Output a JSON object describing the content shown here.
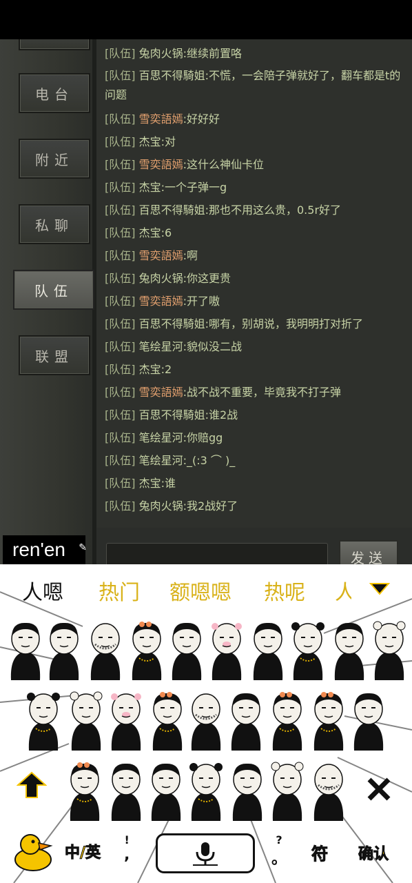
{
  "game": {
    "tabs": [
      {
        "label": "电台",
        "active": false
      },
      {
        "label": "附近",
        "active": false
      },
      {
        "label": "私聊",
        "active": false
      },
      {
        "label": "队伍",
        "active": true
      },
      {
        "label": "联盟",
        "active": false
      }
    ],
    "messages": [
      {
        "tag": "[队伍]",
        "name": "兔肉火锅",
        "text": ":继续前置咯",
        "orange": false
      },
      {
        "tag": "[队伍]",
        "name": "百思不得騎姐",
        "text": ":不慌，一会陪子弹就好了，翻车都是t的问题",
        "orange": false
      },
      {
        "tag": "[队伍]",
        "name": "雪奕語嫣",
        "text": ":好好好",
        "orange": true
      },
      {
        "tag": "[队伍]",
        "name": "杰宝",
        "text": ":对",
        "orange": false
      },
      {
        "tag": "[队伍]",
        "name": "雪奕語嫣",
        "text": ":这什么神仙卡位",
        "orange": true
      },
      {
        "tag": "[队伍]",
        "name": "杰宝",
        "text": ":一个子弹一g",
        "orange": false
      },
      {
        "tag": "[队伍]",
        "name": "百思不得騎姐",
        "text": ":那也不用这么贵，0.5r好了",
        "orange": false
      },
      {
        "tag": "[队伍]",
        "name": "杰宝",
        "text": ":6",
        "orange": false
      },
      {
        "tag": "[队伍]",
        "name": "雪奕語嫣",
        "text": ":啊",
        "orange": true
      },
      {
        "tag": "[队伍]",
        "name": "兔肉火锅",
        "text": ":你这更贵",
        "orange": false
      },
      {
        "tag": "[队伍]",
        "name": "雪奕語嫣",
        "text": ":开了嗷",
        "orange": true
      },
      {
        "tag": "[队伍]",
        "name": "百思不得騎姐",
        "text": ":哪有，别胡说，我明明打对折了",
        "orange": false
      },
      {
        "tag": "[队伍]",
        "name": "笔绘星河",
        "text": ":貌似没二战",
        "orange": false
      },
      {
        "tag": "[队伍]",
        "name": "杰宝",
        "text": ":2",
        "orange": false
      },
      {
        "tag": "[队伍]",
        "name": "雪奕語嫣",
        "text": ":战不战不重要，毕竟我不打子弹",
        "orange": true
      },
      {
        "tag": "[队伍]",
        "name": "百思不得騎姐",
        "text": ":谁2战",
        "orange": false
      },
      {
        "tag": "[队伍]",
        "name": "笔绘星河",
        "text": ":你赔gg",
        "orange": false
      },
      {
        "tag": "[队伍]",
        "name": "笔绘星河",
        "text": ":_(:3 ⌒ )_",
        "orange": false
      },
      {
        "tag": "[队伍]",
        "name": "杰宝",
        "text": ":谁",
        "orange": false
      },
      {
        "tag": "[队伍]",
        "name": "兔肉火锅",
        "text": ":我2战好了",
        "orange": false
      }
    ],
    "send_label": "发送"
  },
  "ime": {
    "composing": "ren'en",
    "candidates": [
      "人嗯",
      "热门",
      "额嗯嗯",
      "热呢",
      "人"
    ],
    "bottom": {
      "lang_label": "中/英",
      "punct_top": "!",
      "punct_bottom": ",",
      "punct2_top": "?",
      "punct2_bottom": "。",
      "symbol_label": "符",
      "confirm_label": "确认"
    },
    "icons": [
      "duck-logo-icon",
      "microphone-icon",
      "up-arrow-icon",
      "close-icon",
      "chevron-down-icon"
    ]
  }
}
